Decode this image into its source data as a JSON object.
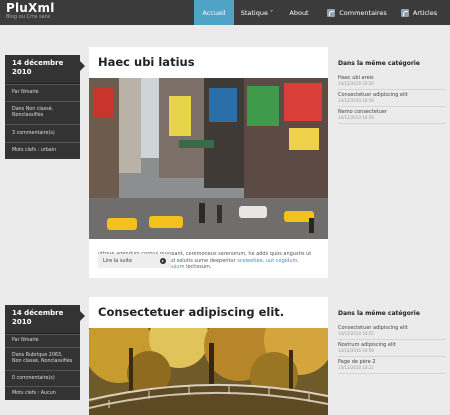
{
  "header": {
    "site_title": "PluXml",
    "tagline": "Blog ou Cms sans",
    "nav": [
      {
        "label": "Accueil",
        "active": true
      },
      {
        "label": "Statique ˅",
        "active": false
      },
      {
        "label": "About",
        "active": false
      },
      {
        "label": "Commentaires",
        "icon": "rss-icon"
      },
      {
        "label": "Articles",
        "icon": "rss-icon"
      }
    ]
  },
  "articles": [
    {
      "date": "14 décembre 2010",
      "meta": [
        "Par Nmarie",
        "Dans Non classé, Nonclassifiés",
        "3 commentaire(s)",
        "Mots clefs : urbain"
      ],
      "title": "Haec ubi latius",
      "excerpt": "uttque agendum corpus quassant, ceremoneus serenorum, he adds quos angustis ut fener, cuius oul incrpeiliset, ad solutis sume deepentur",
      "excerpt_links": "sceleetiee, uut cogidum, rrecendum sofvesliie luuit aiouium",
      "excerpt_tail": "lectissum.",
      "read_more": "Lire la suite",
      "side_heading": "Dans la même catégorie",
      "related": [
        {
          "title": "Haec ubi areis",
          "date": "14/12/2010 10:50"
        },
        {
          "title": "Consectetuer adipiscing elit",
          "date": "14/12/2010 10:59"
        },
        {
          "title": "Nemo consectetuer",
          "date": "14/12/2010 10:59"
        }
      ]
    },
    {
      "date": "14 décembre 2010",
      "meta": [
        "Par Nmarie",
        "Dans Rubrique 2063, Non classé, Nonclassifiés",
        "0 commentaire(s)",
        "Mots clefs : Aucun"
      ],
      "title": "Consectetuer adipiscing elit.",
      "side_heading": "Dans la même catégorie",
      "related": [
        {
          "title": "Consectetuer adipiscing elit",
          "date": "14/12/2010 10:55"
        },
        {
          "title": "Nostrum adipiscing elit",
          "date": "14/12/2010 10:59"
        },
        {
          "title": "Page de père 2",
          "date": "14/12/2010 10:21"
        }
      ]
    }
  ]
}
